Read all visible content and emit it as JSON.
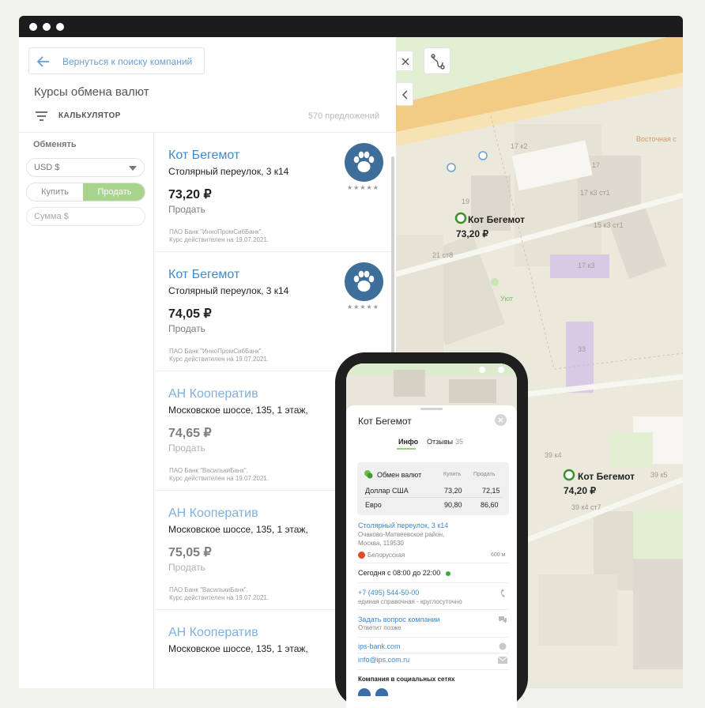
{
  "window": {
    "controls": [
      "close",
      "minimize",
      "maximize"
    ]
  },
  "panel": {
    "back_label": "Вернуться к поиску компаний",
    "title": "Курсы обмена валют",
    "calculator_label": "КАЛЬКУЛЯТОР",
    "offers_count": "570 предложений"
  },
  "filters": {
    "heading": "Обменять",
    "currency": "USD $",
    "buy_label": "Купить",
    "sell_label": "Продать",
    "amount_placeholder": "Сумма $"
  },
  "offers": [
    {
      "name": "Кот Бегемот",
      "address": "Столярный переулок, 3 к14",
      "rate": "73,20 ₽",
      "operation": "Продать",
      "bank": "ПАО Банк \"ИнноПромСибБанк\".",
      "valid": "Курс действителен на 19.07.2021.",
      "stars": "★★★★★"
    },
    {
      "name": "Кот Бегемот",
      "address": "Столярный переулок, 3 к14",
      "rate": "74,05 ₽",
      "operation": "Продать",
      "bank": "ПАО Банк \"ИнноПромСибБанк\".",
      "valid": "Курс действителен на 19.07.2021.",
      "stars": "★★★★★"
    },
    {
      "name": "АН Кооператив",
      "address": "Московское шоссе, 135, 1 этаж,",
      "rate": "74,65 ₽",
      "operation": "Продать",
      "bank": "ПАО Банк \"ВасилькиБанк\".",
      "valid": "Курс действителен на 19.07.2021."
    },
    {
      "name": "АН Кооператив",
      "address": "Московское шоссе, 135, 1 этаж,",
      "rate": "75,05 ₽",
      "operation": "Продать",
      "bank": "ПАО Банк \"ВасилькиБанк\".",
      "valid": "Курс действителен на 19.07.2021."
    },
    {
      "name": "АН Кооператив",
      "address": "Московское шоссе, 135, 1 этаж,"
    }
  ],
  "map": {
    "markers": [
      {
        "name": "Кот Бегемот",
        "rate": "73,20 ₽"
      },
      {
        "name": "Кот Бегемот",
        "rate": "74,20 ₽"
      }
    ],
    "labels": [
      "17 к2",
      "17",
      "19",
      "17 к3 ст1",
      "15 к3 ст1",
      "21 ст8",
      "17 к3",
      "33",
      "39 к4",
      "39 к5",
      "39 к4 ст7",
      "Уют",
      "Восточная с"
    ]
  },
  "phone": {
    "title": "Кот Бегемот",
    "tab_info": "Инфо",
    "tab_reviews": "Отзывы",
    "reviews_count": "35",
    "exchange_title": "Обмен валют",
    "col_buy": "Купить",
    "col_sell": "Продать",
    "rows": [
      {
        "currency": "Доллар США",
        "buy": "73,20",
        "sell": "72,15"
      },
      {
        "currency": "Евро",
        "buy": "90,80",
        "sell": "86,60"
      }
    ],
    "address": "Столярный переулок, 3 к14",
    "address_district": "Очаково-Матвеевское район,",
    "address_city": "Москва, 119530",
    "metro": "Белорусская",
    "metro_distance": "600 м",
    "hours": "Сегодня с 08:00 до 22:00",
    "phone_number": "+7 (495) 544-50-00",
    "phone_note": "единая справочная - круглосуточно",
    "ask_link": "Задать вопрос компании",
    "ask_note": "Ответит позже",
    "website": "ips-bank.com",
    "email": "info@ips.com.ru",
    "social_heading": "Компания в социальных сетях"
  },
  "colors": {
    "accent": "#3f8acc",
    "green": "#a9d48e",
    "marker": "#3f8f2e",
    "logo": "#3e6f9b"
  }
}
